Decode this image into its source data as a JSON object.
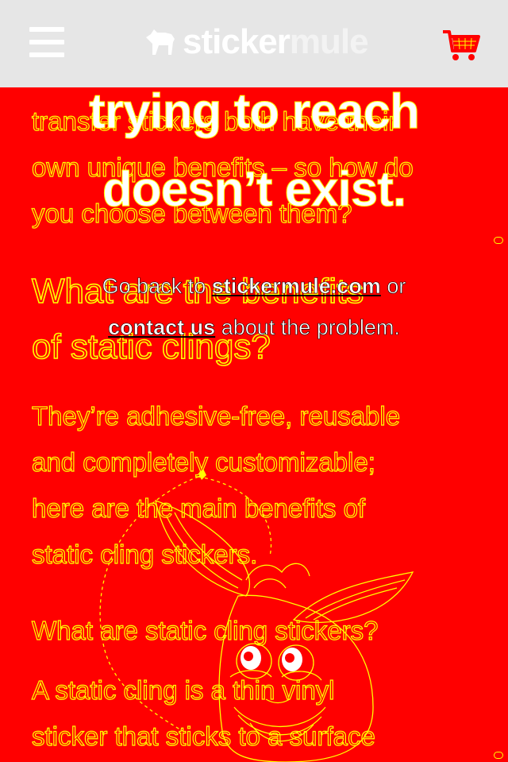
{
  "header": {
    "logo_primary": "sticker",
    "logo_secondary": "mule",
    "colors": {
      "bar": "#e6e6e6",
      "cart": "#ff0000"
    }
  },
  "article": {
    "p1_lines": [
      "transfer stickers both have their",
      "own unique benefits – so how do",
      "you choose between them?"
    ],
    "h2_lines": [
      "What are the benefits",
      "of static clings?"
    ],
    "p2_lines": [
      "They’re adhesive-free, reusable",
      "and completely customizable;",
      "here are the main benefits of",
      "static cling stickers."
    ],
    "h3": "What are static cling stickers?",
    "p3_lines": [
      "A static cling is a thin vinyl",
      "sticker that sticks to a surface"
    ]
  },
  "error": {
    "title_line1": "trying to reach",
    "title_line2": "doesn’t exist.",
    "go_back_prefix": "Go back to ",
    "go_back_link": "stickermule.com",
    "go_back_suffix": " or",
    "contact_link": "contact us",
    "contact_suffix": " about the problem."
  },
  "colors": {
    "background": "#ff0000",
    "outline": "#ffff00"
  }
}
